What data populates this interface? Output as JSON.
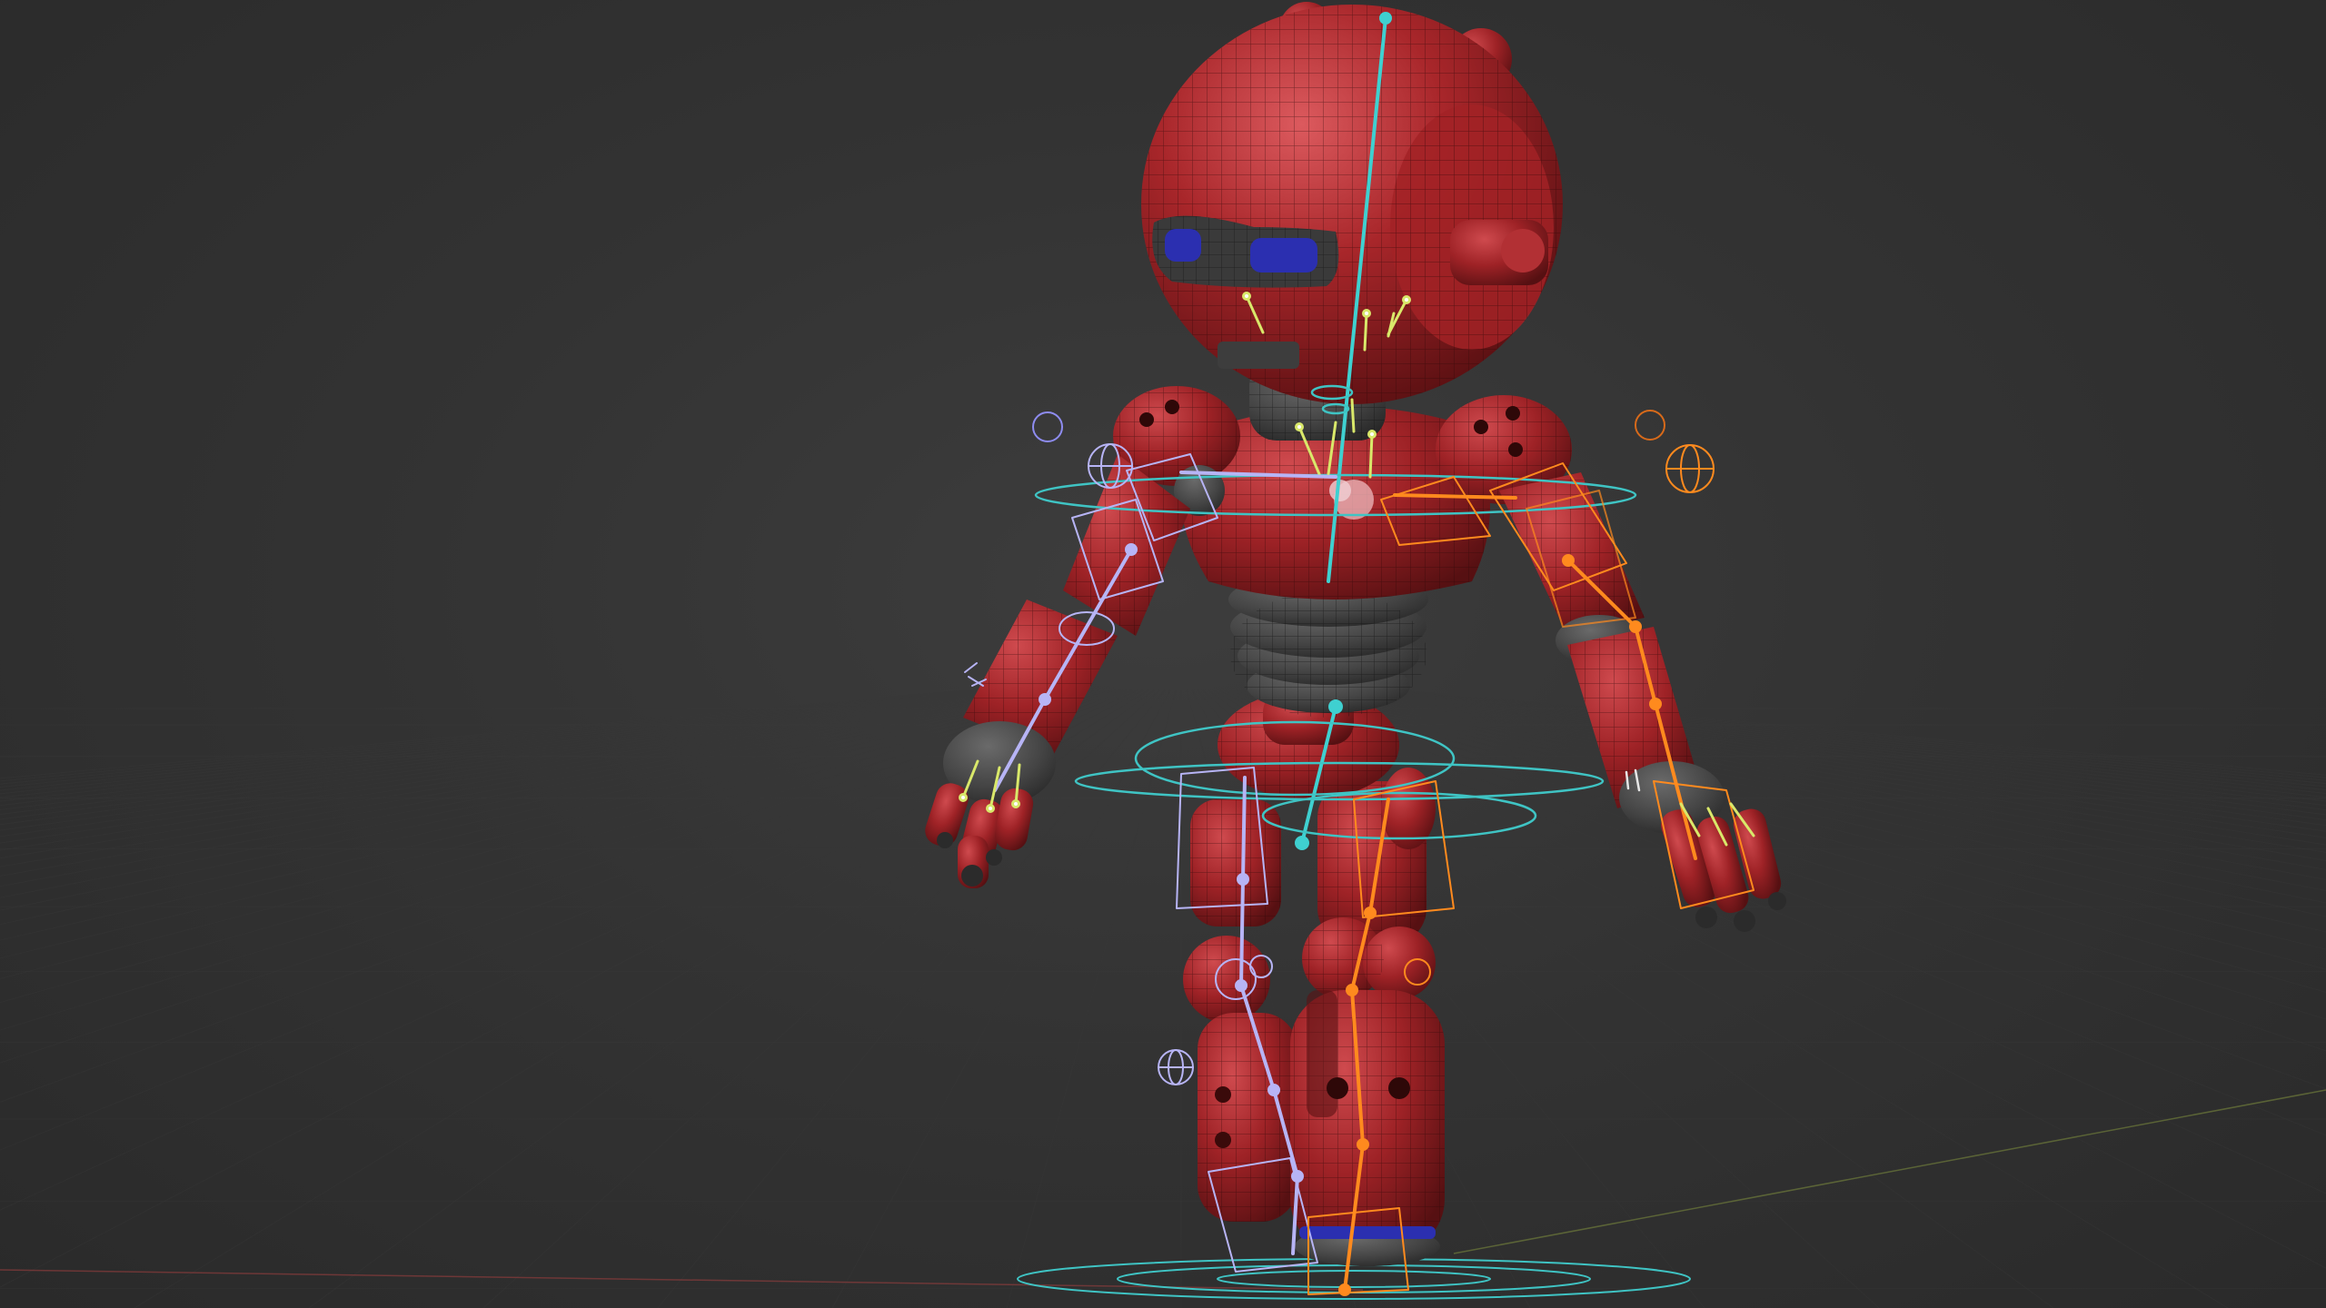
{
  "viewport": {
    "background_color": "#333333",
    "grid_line_color": "#3a3a3a",
    "x_axis_color": "#8a3c3c",
    "y_axis_color": "#6e7a3a"
  },
  "robot": {
    "body_color": "#a8262a",
    "body_highlight": "#d64a4e",
    "body_shadow": "#5e1214",
    "joint_color": "#4a4a4a",
    "eye_color": "#2b2fb0",
    "wire_color": "#2a0808"
  },
  "rig": {
    "spine_color": "#3fd0d0",
    "left_side_color": "#b7b4f5",
    "right_side_color": "#ff8a1e",
    "control_circle_color": "#3fc4c4",
    "face_bone_color": "#d9e86a"
  }
}
